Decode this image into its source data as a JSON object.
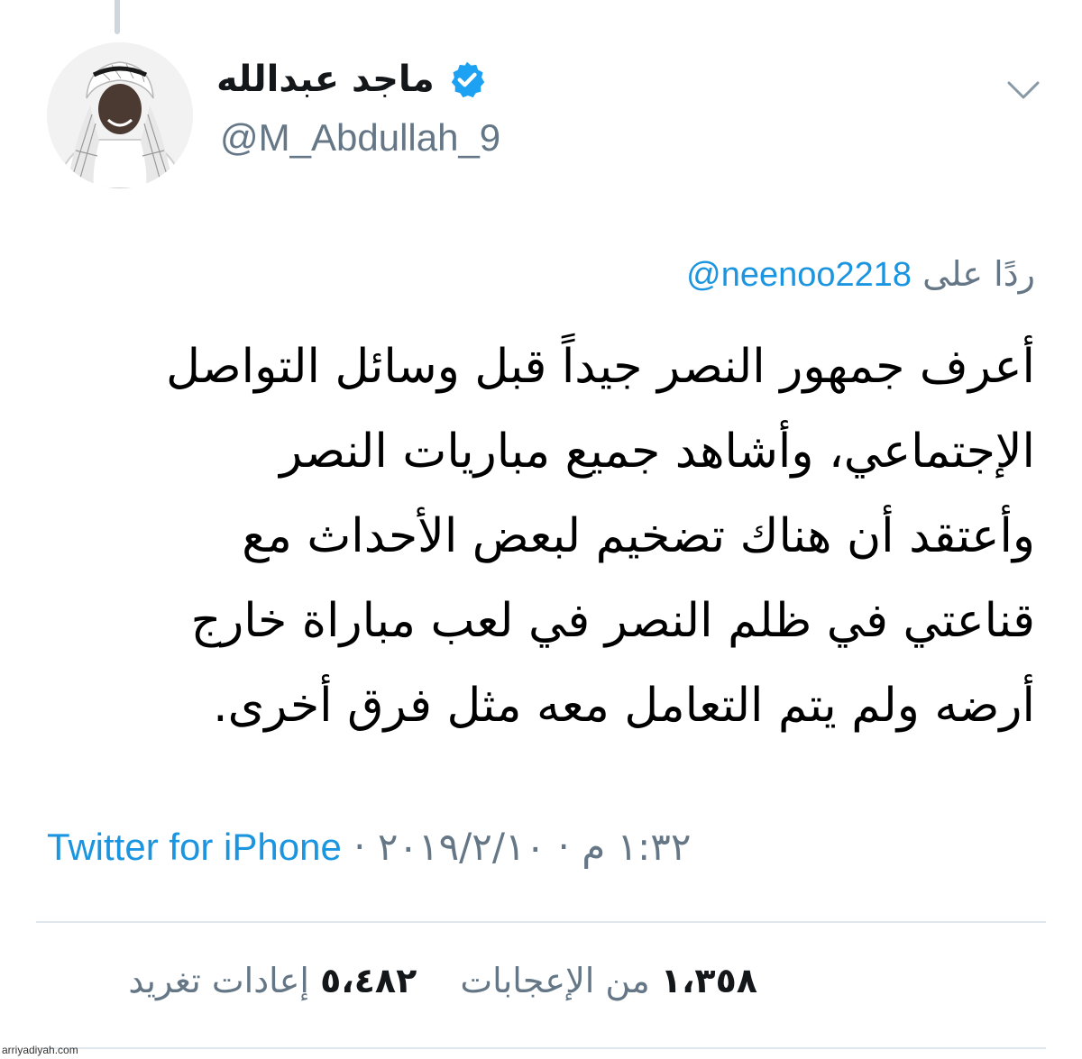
{
  "tweet": {
    "display_name": "ماجد عبدالله",
    "handle": "@M_Abdullah_9",
    "verified": true,
    "verified_icon": "verified-badge-icon",
    "menu_icon": "chevron-down-icon",
    "reply_prefix": "ردًا على",
    "reply_to": "@neenoo2218",
    "text_lines": [
      "أعرف جمهور النصر جيداً قبل وسائل التواصل",
      "الإجتماعي، وأشاهد جميع مباريات النصر",
      "وأعتقد أن هناك تضخيم لبعض الأحداث مع",
      "قناعتي في ظلم النصر في لعب مباراة خارج",
      "أرضه ولم يتم التعامل معه مثل فرق أخرى."
    ],
    "time": "١:٣٢ م",
    "date": "٢٠١٩/٢/١٠",
    "separator": "·",
    "source": "Twitter for iPhone",
    "retweets_count": "١،٣٥٨",
    "retweets_label": "من الإعجابات",
    "likes_count": "٥،٤٨٢",
    "likes_label": "إعادات تغريد"
  },
  "colors": {
    "link": "#1b95e0",
    "secondary_text": "#657786",
    "primary_text": "#14171a",
    "divider": "#e1e8ed"
  },
  "watermark": "arriyadiyah.com"
}
